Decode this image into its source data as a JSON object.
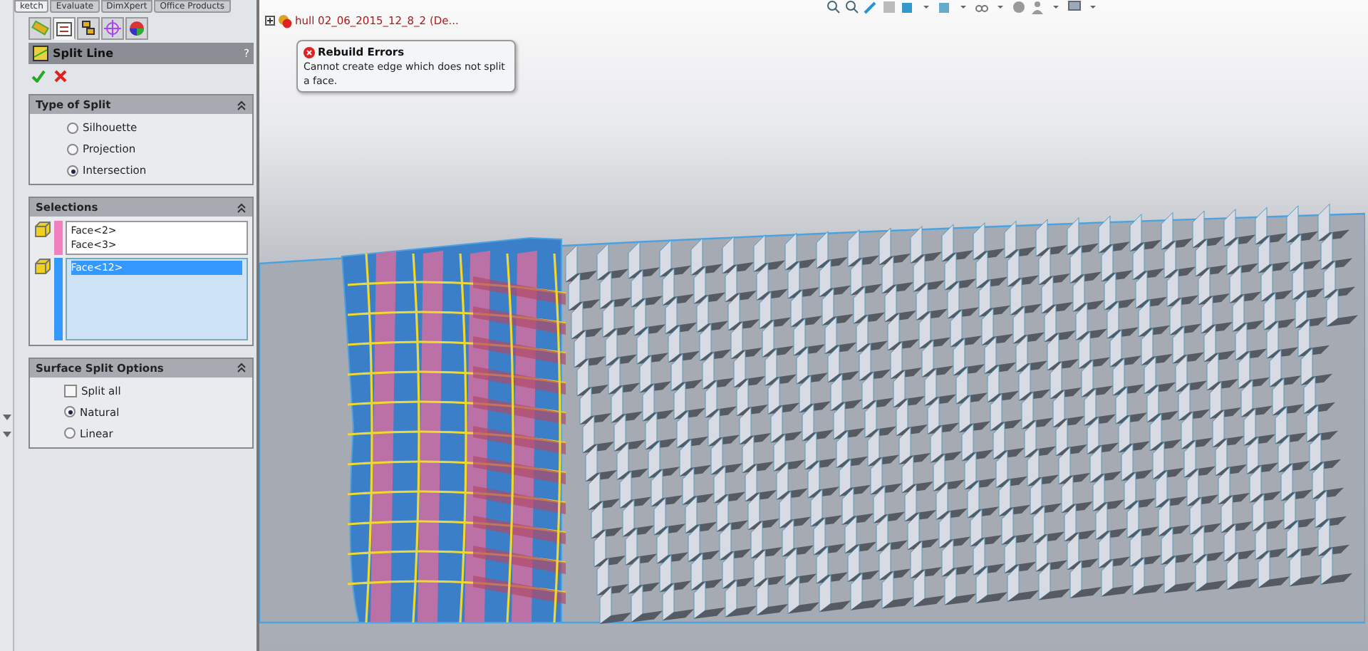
{
  "ribbon_tabs": [
    {
      "label": "ketch",
      "selected": true
    },
    {
      "label": "Evaluate",
      "selected": false
    },
    {
      "label": "DimXpert",
      "selected": false
    },
    {
      "label": "Office Products",
      "selected": false
    }
  ],
  "panel_tabs": [
    {
      "kind": "feature",
      "selected": false
    },
    {
      "kind": "property",
      "selected": true
    },
    {
      "kind": "config",
      "selected": false
    },
    {
      "kind": "dimxpert",
      "selected": false
    },
    {
      "kind": "display",
      "selected": false
    }
  ],
  "property_manager": {
    "title": "Split Line",
    "help": "?"
  },
  "type_of_split": {
    "title": "Type of Split",
    "options": [
      {
        "label": "Silhouette",
        "selected": false
      },
      {
        "label": "Projection",
        "selected": false
      },
      {
        "label": "Intersection",
        "selected": true
      }
    ]
  },
  "selections": {
    "title": "Selections",
    "lists": [
      {
        "color": "#f080c0",
        "items": [
          {
            "label": "Face<2>",
            "selected": false
          },
          {
            "label": "Face<3>",
            "selected": false
          }
        ]
      },
      {
        "color": "#3399ff",
        "items": [
          {
            "label": "Face<12>",
            "selected": true
          }
        ]
      }
    ]
  },
  "surface_split_options": {
    "title": "Surface Split Options",
    "split_all": {
      "label": "Split all",
      "checked": false
    },
    "methods": [
      {
        "label": "Natural",
        "selected": true
      },
      {
        "label": "Linear",
        "selected": false
      }
    ]
  },
  "tree": {
    "expanded": false,
    "label": "hull 02_06_2015_12_8_2  (De..."
  },
  "tooltip": {
    "title": "Rebuild Errors",
    "message": "Cannot create edge which does not split a face."
  }
}
